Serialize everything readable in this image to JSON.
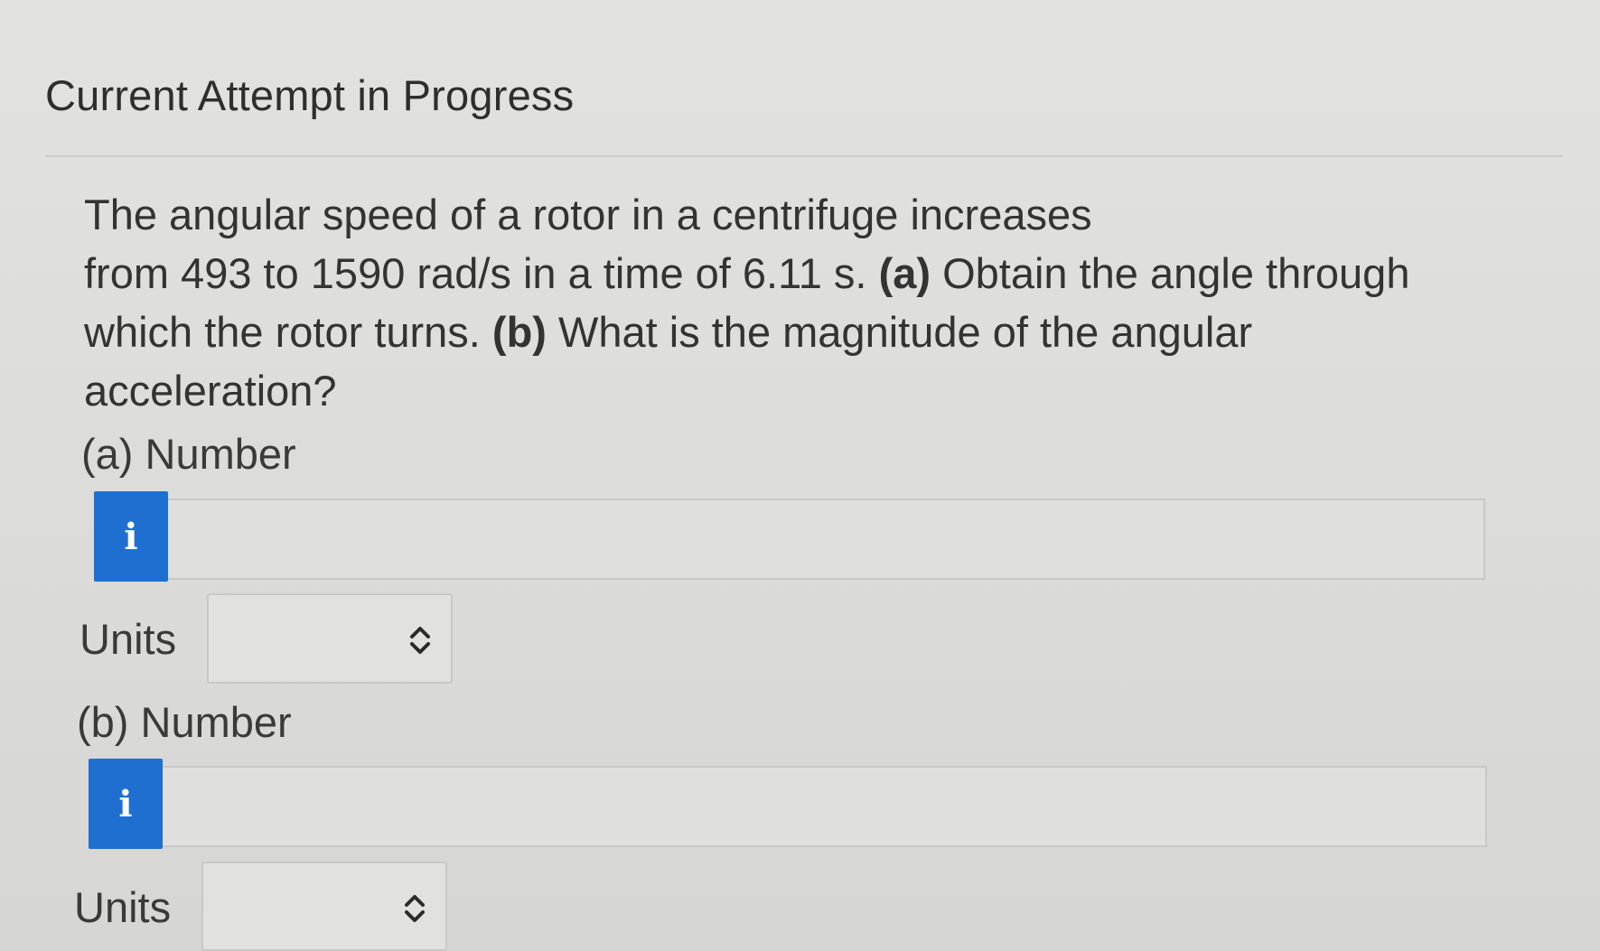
{
  "header": {
    "title": "Current Attempt in Progress"
  },
  "question": {
    "line1": "The angular speed of a rotor in a centrifuge increases",
    "line2_pre": "from 493 to 1590 rad/s in a time of 6.11 s. ",
    "line2_bold": "(a)",
    "line2_post": " Obtain the angle through",
    "line3_pre": "which the rotor turns. ",
    "line3_bold": "(b)",
    "line3_post": " What is the magnitude of the angular",
    "line4": "acceleration?"
  },
  "part_a": {
    "label": "(a) Number",
    "info_icon": "i",
    "number_value": "",
    "units_label": "Units",
    "units_value": ""
  },
  "part_b": {
    "label": "(b) Number",
    "info_icon": "i",
    "number_value": "",
    "units_label": "Units",
    "units_value": ""
  },
  "colors": {
    "info_button": "#1f6fd1",
    "background": "#dcdcda"
  }
}
